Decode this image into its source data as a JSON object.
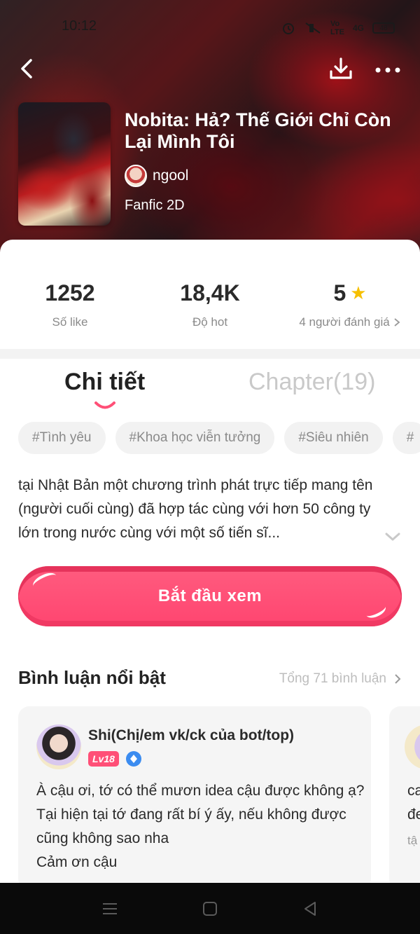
{
  "status": {
    "time": "10:12",
    "battery": "48",
    "network": "4G"
  },
  "book": {
    "title": "Nobita: Hả? Thế Giới Chỉ Còn Lại Mình Tôi",
    "author": "ngool",
    "genre": "Fanfic 2D"
  },
  "stats": {
    "likes_value": "1252",
    "likes_label": "Số like",
    "hot_value": "18,4K",
    "hot_label": "Độ hot",
    "rating_value": "5",
    "rating_label": "4 người đánh giá"
  },
  "tabs": {
    "detail": "Chi tiết",
    "chapters": "Chapter(19)"
  },
  "tags": [
    "#Tình yêu",
    "#Khoa học viễn tưởng",
    "#Siêu nhiên",
    "#"
  ],
  "description": "tại Nhật Bản một chương trình phát trực tiếp mang tên (người cuối cùng) đã hợp tác cùng với hơn 50 công ty lớn trong nước cùng với một số tiến sĩ...",
  "start_button": "Bắt đầu xem",
  "comments": {
    "title": "Bình luận nổi bật",
    "total": "Tổng 71 bình luận",
    "items": [
      {
        "name": "Shi(Chị/em vk/ck của bot/top)",
        "level": "Lv18",
        "text": "À cậu ơi, tớ có thể mươn idea cậu được không ạ? Tại hiện tại tớ đang rất bí ý ấy, nếu không được cũng không sao nha\nCảm ơn cậu"
      }
    ],
    "next_preview": {
      "line1": "ca",
      "line2": "đe",
      "meta": "tậ"
    }
  },
  "colors": {
    "accent": "#ff4f77",
    "star": "#f6c000"
  }
}
